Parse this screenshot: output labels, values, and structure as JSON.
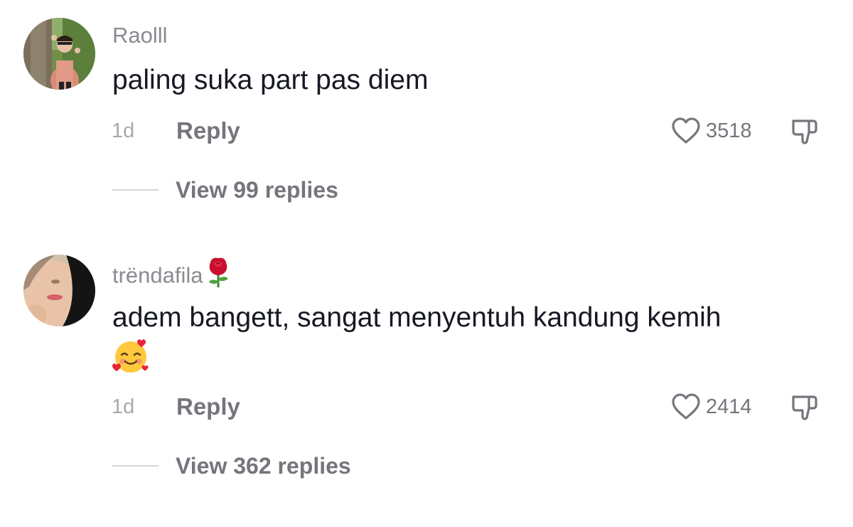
{
  "comments": [
    {
      "username": "Raolll",
      "username_emoji": "",
      "text": "paling suka part pas diem",
      "text_emoji": "",
      "timestamp": "1d",
      "reply_label": "Reply",
      "like_count": "3518",
      "view_replies_label": "View 99 replies"
    },
    {
      "username": "trëndafila",
      "username_emoji": "rose-emoji",
      "text": "adem bangett, sangat menyentuh kandung kemih",
      "text_emoji": "smiling-face-with-hearts-emoji",
      "timestamp": "1d",
      "reply_label": "Reply",
      "like_count": "2414",
      "view_replies_label": "View 362 replies"
    }
  ],
  "icons": {
    "like": "heart-outline-icon",
    "dislike": "thumbs-down-outline-icon"
  },
  "colors": {
    "username": "#8a8b91",
    "comment_text": "#161823",
    "secondary_text": "#75767c",
    "timestamp": "#a8a9ae",
    "divider": "#d6d7da",
    "background": "#ffffff"
  }
}
